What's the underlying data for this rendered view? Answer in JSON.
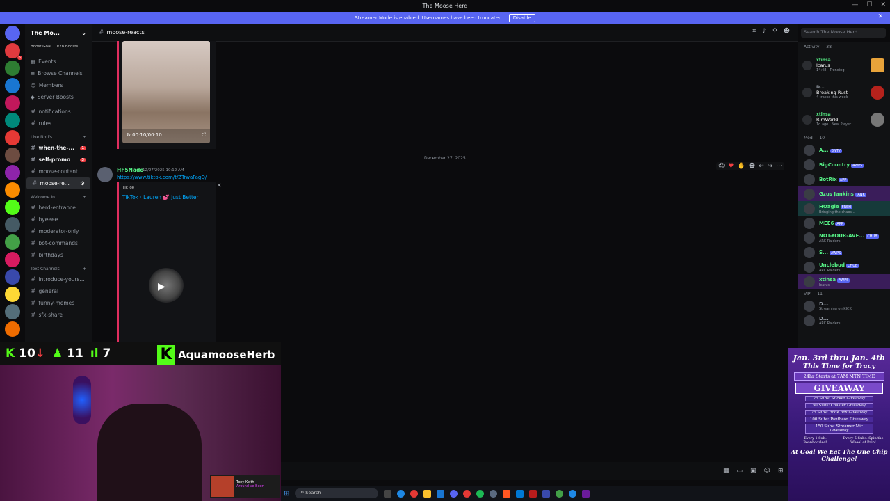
{
  "window": {
    "title": "The Moose Herd"
  },
  "banner": {
    "text": "Streamer Mode is enabled. Usernames have been truncated.",
    "button": "Disable"
  },
  "server": {
    "name": "The Mo...",
    "boost_goal": "Boost Goal",
    "boost_count": "0/28 Boosts",
    "nav": [
      "Events",
      "Browse Channels",
      "Members",
      "Server Boosts"
    ],
    "pinned": [
      "notifications",
      "rules"
    ],
    "cat_live": "Live Noti's",
    "live": [
      {
        "name": "when-the-...",
        "count": "1"
      },
      {
        "name": "self-promo",
        "count": "3"
      },
      {
        "name": "moose-content",
        "count": ""
      },
      {
        "name": "moose-re...",
        "count": ""
      }
    ],
    "cat_welcome": "Welcome In",
    "welcome": [
      "herd-entrance",
      "byeeee",
      "moderator-only",
      "bot-commands",
      "birthdays"
    ],
    "cat_text": "Text Channels",
    "text": [
      "introduce-yours...",
      "general",
      "funny-memes",
      "sfx-share"
    ]
  },
  "header": {
    "channel": "moose-reacts",
    "search_placeholder": "Search The Moose Herd"
  },
  "chat": {
    "video_time": "00:10/00:10",
    "date_divider": "December 27, 2025",
    "author": "HF5Nado",
    "timestamp": "12/27/2025 10:12 AM",
    "link": "https://www.tiktok.com/t/ZTrwaFagQ/",
    "embed_provider": "TikTok",
    "embed_title": "TikTok · Lauren 💕 Just Better"
  },
  "members": {
    "activity_title": "Activity — 38",
    "activities": [
      {
        "user": "xtinsa",
        "title": "Icarus",
        "meta": "14:48 · Trending",
        "color": "#e8a33a"
      },
      {
        "user": "D...",
        "title": "Breaking Rust",
        "meta": "4 tracks this week",
        "color": "#b5221c"
      },
      {
        "user": "xtinsa",
        "title": "RimWorld",
        "meta": "1d ago · New Player",
        "color": "#777777"
      }
    ],
    "mod_title": "Mod — 10",
    "mods": [
      {
        "name": "A...",
        "tag": "BNTY",
        "sub": ""
      },
      {
        "name": "BigCountry",
        "tag": "AWPS",
        "sub": ""
      },
      {
        "name": "BotRix",
        "tag": "APP",
        "sub": ""
      },
      {
        "name": "Gzus Jankins",
        "tag": "JANK",
        "sub": ""
      },
      {
        "name": "HOagie",
        "tag": "FRSH",
        "sub": "Bringing the chaos..."
      },
      {
        "name": "MEE6",
        "tag": "APP",
        "sub": ""
      },
      {
        "name": "NOT-YOUR-AVE...",
        "tag": "CHUB",
        "sub": "ARC Raiders"
      },
      {
        "name": "S...",
        "tag": "AWPS",
        "sub": ""
      },
      {
        "name": "Unclebud",
        "tag": "CHUB",
        "sub": "ARC Raiders"
      },
      {
        "name": "xtinsa",
        "tag": "AWPS",
        "sub": "Icarus"
      }
    ],
    "vip_title": "VIP — 11",
    "vips": [
      {
        "name": "D...",
        "tag": "",
        "sub": "Streaming on KICK"
      },
      {
        "name": "D...",
        "tag": "",
        "sub": "ARC Raiders"
      }
    ]
  },
  "overlay": {
    "stat1": "10",
    "stat2": "11",
    "stat3": "7",
    "channel_name": "AquamooseHerb",
    "spotify_track": "Tony Keith",
    "spotify_artist": "Around ve Been"
  },
  "taskbar": {
    "search": "Search"
  },
  "giveaway": {
    "line1": "Jan. 3rd thru Jan. 4th",
    "line2": "This Time for Tracy",
    "line3": "24hr Starts at 7AM MTN TIME",
    "big": "GIVEAWAY",
    "tiers": [
      "25 Subs: Sticker Giveaway",
      "50 Subs: Coaster Giveaway",
      "75 Subs: Book Box Giveaway",
      "100 Subs: Pantheon Giveaway",
      "150 Subs: Streamer Mic Giveaway"
    ],
    "every1": "Every 1 Sub: Beanboozled!",
    "every5": "Every 5 Subs: Spin the Wheel of Pain!",
    "footer": "At Goal We Eat The One Chip Challenge!"
  }
}
